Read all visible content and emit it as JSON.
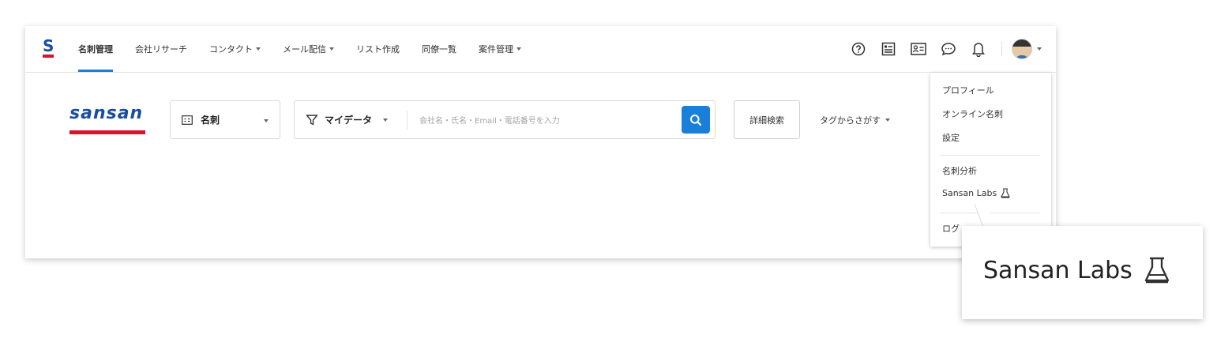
{
  "nav": {
    "items": [
      {
        "label": "名刺管理",
        "active": true,
        "caret": false
      },
      {
        "label": "会社リサーチ",
        "active": false,
        "caret": false
      },
      {
        "label": "コンタクト",
        "active": false,
        "caret": true
      },
      {
        "label": "メール配信",
        "active": false,
        "caret": true
      },
      {
        "label": "リスト作成",
        "active": false,
        "caret": false
      },
      {
        "label": "同僚一覧",
        "active": false,
        "caret": false
      },
      {
        "label": "案件管理",
        "active": false,
        "caret": true
      }
    ]
  },
  "header_icons": [
    "help-icon",
    "list-view-icon",
    "contact-card-icon",
    "chat-icon",
    "bell-icon"
  ],
  "brand": {
    "wordmark": "sansan",
    "logo_letter": "S"
  },
  "search": {
    "card_type_label": "名刺",
    "filter_label": "マイデータ",
    "placeholder": "会社名・氏名・Email・電話番号を入力",
    "value": "",
    "advanced_label": "詳細検索",
    "tag_search_label": "タグからさがす"
  },
  "user_menu": {
    "section1": [
      "プロフィール",
      "オンライン名刺",
      "設定"
    ],
    "section2": [
      "名刺分析",
      "Sansan Labs"
    ],
    "section3": [
      "ログ"
    ]
  },
  "callout": {
    "label": "Sansan Labs"
  },
  "colors": {
    "accent": "#1a7fd9",
    "brand_blue": "#1a4d9e",
    "brand_red": "#d8122d"
  }
}
